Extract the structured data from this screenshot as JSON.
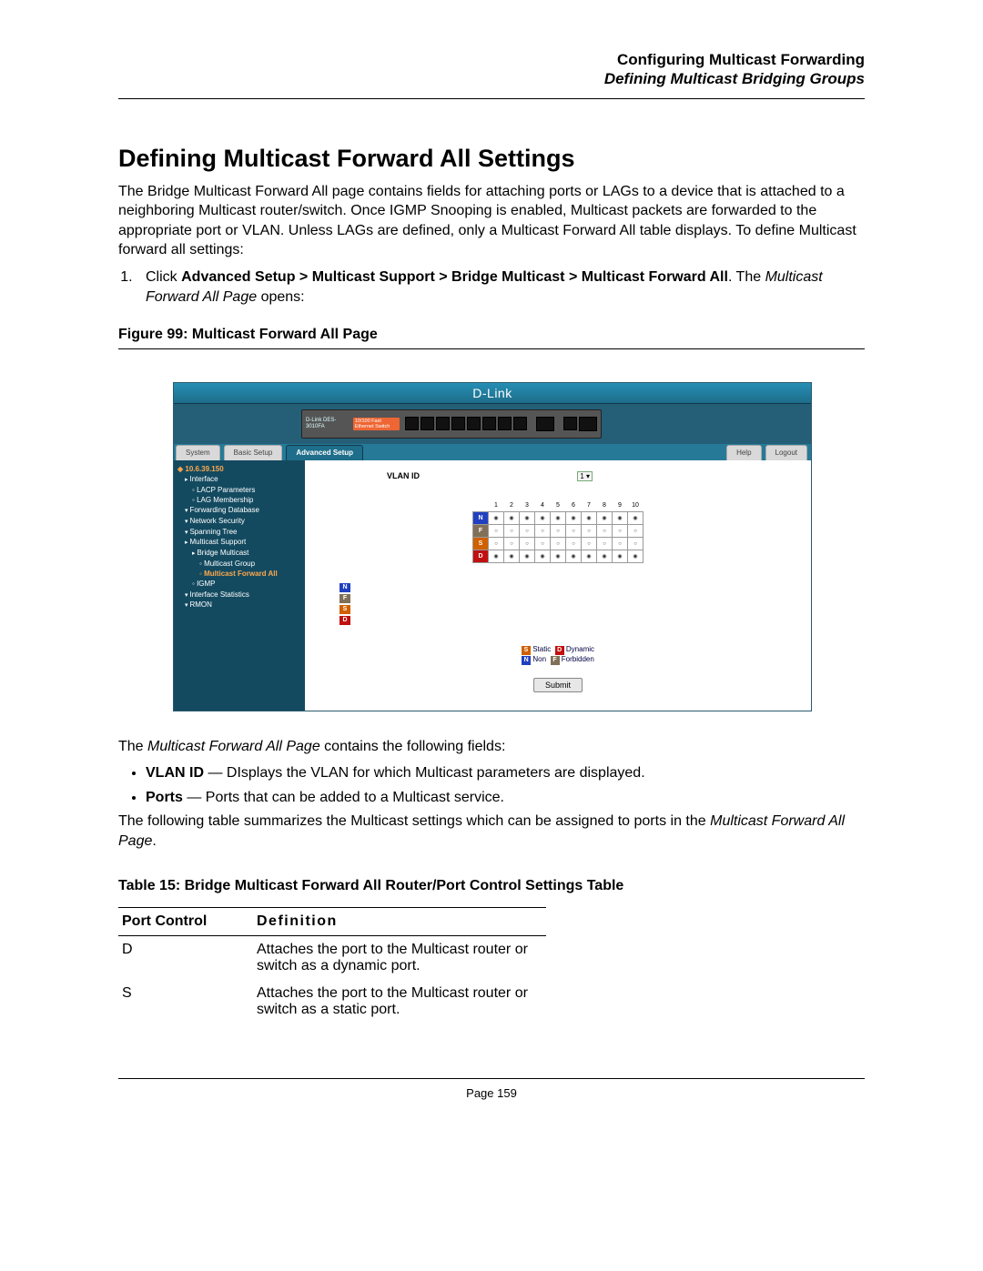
{
  "header": {
    "right_top": "Configuring Multicast Forwarding",
    "right_sub": "Defining Multicast Bridging Groups"
  },
  "h1": "Defining Multicast Forward All Settings",
  "intro": "The Bridge Multicast Forward All page contains fields for attaching ports or LAGs to a device that is attached to a neighboring Multicast router/switch. Once IGMP Snooping is enabled, Multicast packets are forwarded to the appropriate port or VLAN. Unless LAGs are defined, only a Multicast Forward All table displays. To define Multicast forward all settings:",
  "step1": {
    "prefix": "Click ",
    "path": "Advanced Setup > Multicast Support > Bridge Multicast > Multicast Forward All",
    "mid": ". The ",
    "page_name": "Multicast Forward All Page",
    "suffix": " opens:"
  },
  "figure_caption": "Figure 99:  Multicast Forward All Page",
  "screenshot": {
    "logo": "D-Link",
    "device_model": "D-Link DES-3010FA",
    "device_tag": "10/100 Fast Ethernet Switch",
    "tabs": {
      "system": "System",
      "basic": "Basic Setup",
      "advanced": "Advanced Setup",
      "help": "Help",
      "logout": "Logout"
    },
    "sidebar": {
      "ip": "10.6.39.150",
      "items": [
        "Interface",
        "LACP Parameters",
        "LAG Membership",
        "Forwarding Database",
        "Network Security",
        "Spanning Tree",
        "Multicast Support",
        "Bridge Multicast",
        "Multicast Group",
        "Multicast Forward All",
        "IGMP",
        "Interface Statistics",
        "RMON"
      ]
    },
    "panel": {
      "vlan_label": "VLAN ID",
      "vlan_value": "1 ▾",
      "cols": [
        "1",
        "2",
        "3",
        "4",
        "5",
        "6",
        "7",
        "8",
        "9",
        "10"
      ],
      "rows": [
        "N",
        "F",
        "S",
        "D"
      ],
      "legend_rows": [
        "N",
        "F",
        "S",
        "D"
      ],
      "legend": {
        "S": "Static",
        "D": "Dynamic",
        "N": "Non",
        "F": "Forbidden"
      },
      "submit": "Submit"
    }
  },
  "after_fig_line": {
    "pre": "The ",
    "em": "Multicast Forward All Page",
    "post": " contains the following fields:"
  },
  "bullets": [
    {
      "b": "VLAN ID",
      "rest": " — DIsplays the VLAN for which Multicast parameters are displayed."
    },
    {
      "b": "Ports",
      "rest": " — Ports that can be added to a Multicast service."
    }
  ],
  "after_bullets": {
    "pre": "The following table summarizes the Multicast settings which can be assigned to ports in the ",
    "em": "Multicast Forward All Page",
    "post": "."
  },
  "table": {
    "caption": "Table 15:     Bridge Multicast Forward All Router/Port Control Settings Table",
    "h1": "Port Control",
    "h2": "Definition",
    "rows": [
      {
        "c1": "D",
        "c2": "Attaches the port to the Multicast router or switch as a dynamic port."
      },
      {
        "c1": "S",
        "c2": "Attaches the port to the Multicast router or switch as a static port."
      }
    ]
  },
  "footer": "Page 159"
}
